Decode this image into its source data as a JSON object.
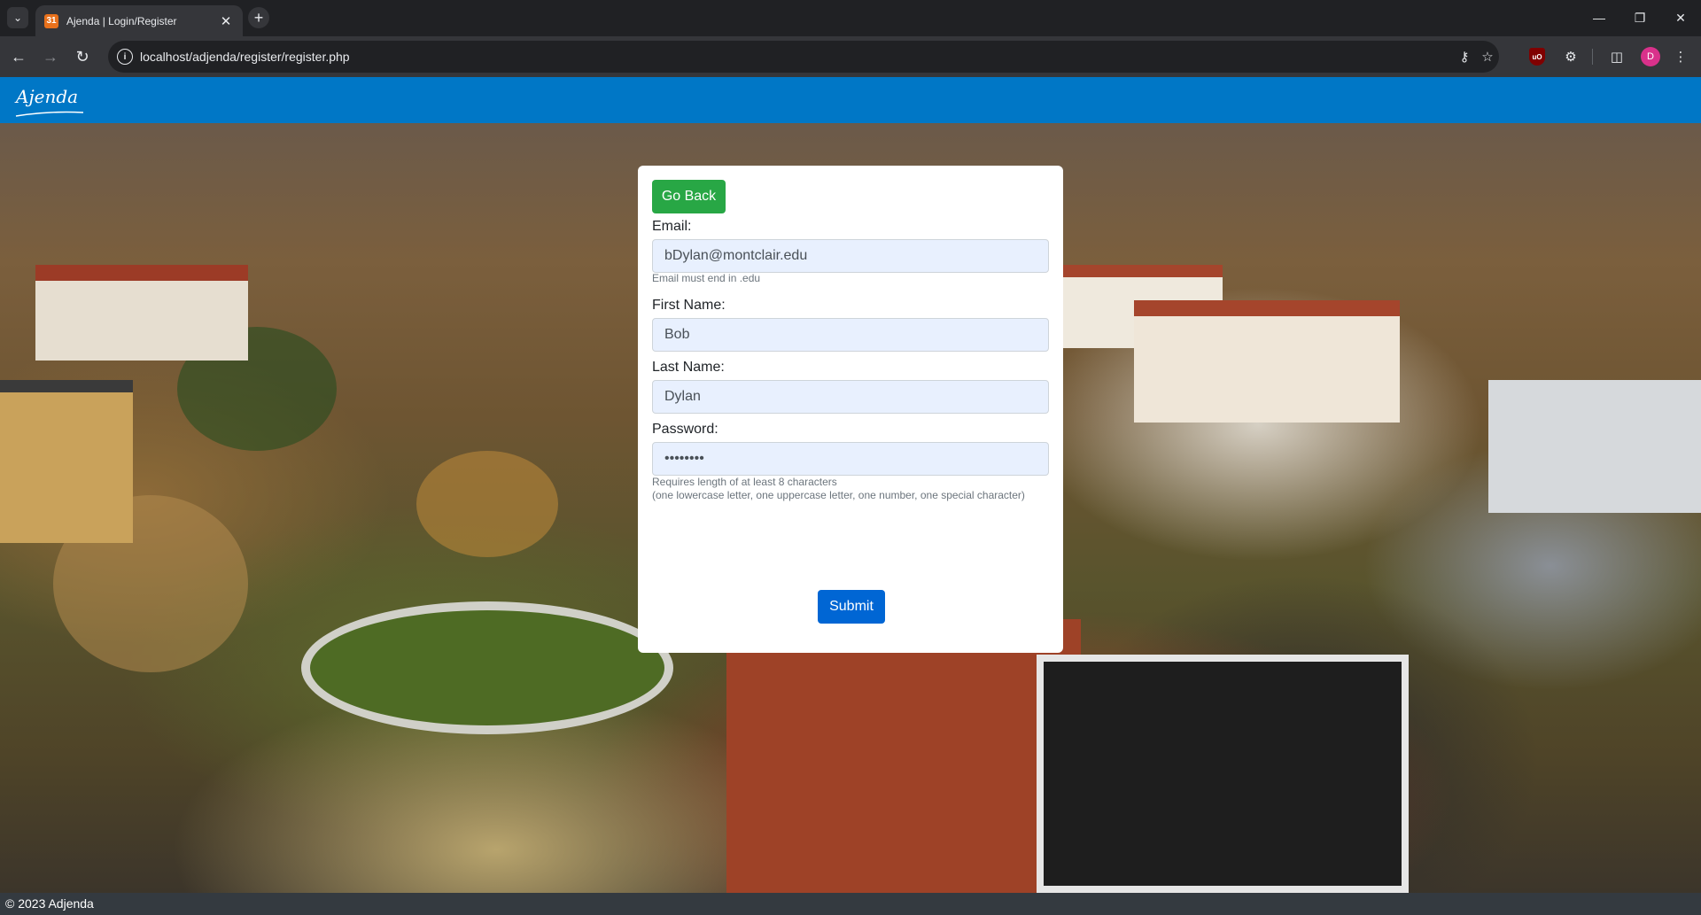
{
  "browser": {
    "tab_title": "Ajenda | Login/Register",
    "tab_favicon": "calendar-favicon",
    "url": "localhost/adjenda/register/register.php",
    "profile_initial": "D",
    "icons": [
      "tab-search-icon",
      "close-icon",
      "new-tab-icon",
      "back-icon",
      "forward-icon",
      "reload-icon",
      "site-info-icon",
      "key-icon",
      "star-icon",
      "ublock-icon",
      "extensions-icon",
      "side-panel-icon",
      "menu-icon",
      "minimize-icon",
      "maximize-icon",
      "window-close-icon"
    ]
  },
  "site": {
    "logo_text": "Ajenda",
    "brand_color": "#0077c6"
  },
  "form": {
    "back_label": "Go Back",
    "email_label": "Email:",
    "email_value": "bDylan@montclair.edu",
    "email_help": "Email must end in .edu",
    "first_name_label": "First Name:",
    "first_name_value": "Bob",
    "last_name_label": "Last Name:",
    "last_name_value": "Dylan",
    "password_label": "Password:",
    "password_value": "••••••••",
    "password_help_1": "Requires length of at least 8 characters",
    "password_help_2": "(one lowercase letter, one uppercase letter, one number, one special character)",
    "submit_label": "Submit"
  },
  "footer": {
    "text": "© 2023 Adjenda"
  }
}
